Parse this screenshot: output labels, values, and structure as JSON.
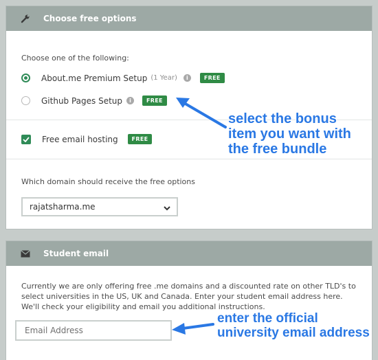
{
  "free_options": {
    "title": "Choose free options",
    "prompt": "Choose one of the following:",
    "options": [
      {
        "label": "About.me Premium Setup",
        "note": "(1 Year)",
        "badge": "FREE",
        "selected": true
      },
      {
        "label": "Github Pages Setup",
        "badge": "FREE",
        "selected": false
      }
    ],
    "email_hosting": {
      "label": "Free email hosting",
      "badge": "FREE",
      "checked": true
    },
    "domain_question": "Which domain should receive the free options",
    "domain_value": "rajatsharma.me"
  },
  "student_email": {
    "title": "Student email",
    "description": "Currently we are only offering free .me domains and a discounted rate on other TLD's to select universities in the US, UK and Canada. Enter your student email address here. We'll check your eligibility and email you additional instructions.",
    "placeholder": "Email Address"
  },
  "annotations": {
    "bonus": "select the bonus\nitem you want with\nthe free bundle",
    "email": "enter the official\nuniversity email address"
  },
  "colors": {
    "accent_green": "#2f8b57",
    "annotation_blue": "#2a78e4",
    "header_gray": "#9da9a5"
  },
  "icons": {
    "header1": "wrench-icon",
    "header2": "envelope-icon",
    "info": "info-icon",
    "select": "chevron-down-icon"
  }
}
